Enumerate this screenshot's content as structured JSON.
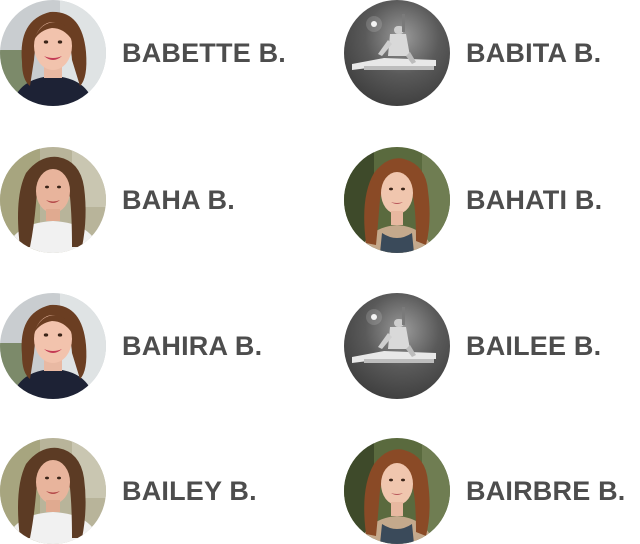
{
  "profiles": [
    {
      "name": "BABETTE B.",
      "avatar": "avatar-woman-smiling-dark-top"
    },
    {
      "name": "BABITA B.",
      "avatar": "avatar-pianist-grayscale"
    },
    {
      "name": "BAHA B.",
      "avatar": "avatar-woman-long-hair-white-top"
    },
    {
      "name": "BAHATI B.",
      "avatar": "avatar-woman-red-hair-forest"
    },
    {
      "name": "BAHIRA B.",
      "avatar": "avatar-woman-smiling-dark-top"
    },
    {
      "name": "BAILEE B.",
      "avatar": "avatar-pianist-grayscale"
    },
    {
      "name": "BAILEY B.",
      "avatar": "avatar-woman-long-hair-white-top"
    },
    {
      "name": "BAIRBRE B.",
      "avatar": "avatar-woman-red-hair-forest"
    }
  ]
}
